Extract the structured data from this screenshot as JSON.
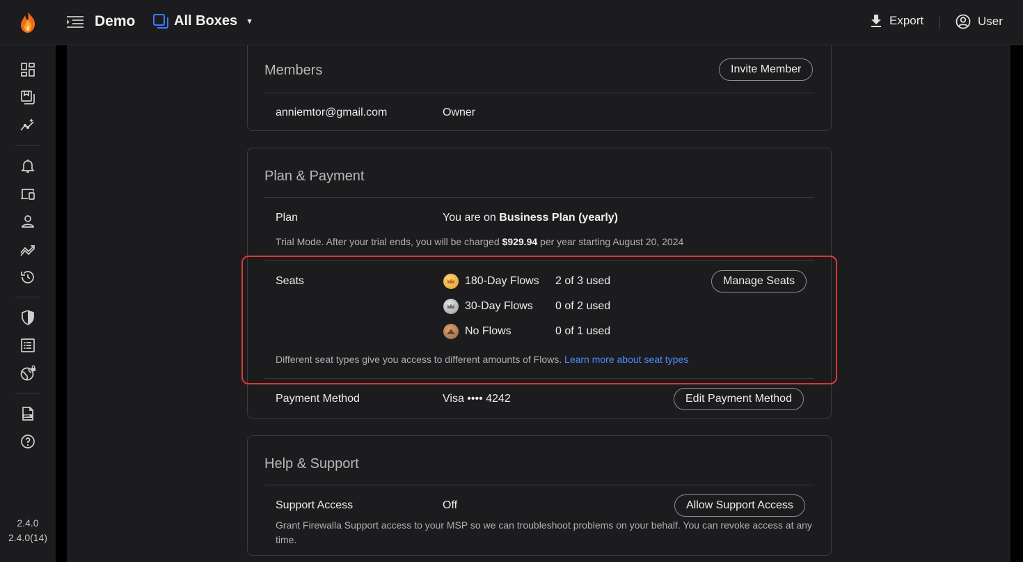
{
  "header": {
    "app_name": "Demo",
    "box_selector": "All Boxes",
    "export_label": "Export",
    "user_label": "User"
  },
  "sidebar": {
    "version": "2.4.0",
    "build": "2.4.0(14)"
  },
  "members": {
    "title": "Members",
    "invite_label": "Invite Member",
    "rows": [
      {
        "email": "anniemtor@gmail.com",
        "role": "Owner"
      }
    ]
  },
  "plan_payment": {
    "title": "Plan & Payment",
    "plan_label": "Plan",
    "plan_prefix": "You are on",
    "plan_name": "Business Plan (yearly)",
    "trial_prefix": "Trial Mode. After your trial ends, you will be charged",
    "trial_price": "$929.94",
    "trial_suffix": "per year starting August 20, 2024",
    "seats_label": "Seats",
    "manage_seats_label": "Manage Seats",
    "seats": [
      {
        "name": "180-Day Flows",
        "usage": "2 of 3 used",
        "tier": "gold"
      },
      {
        "name": "30-Day Flows",
        "usage": "0 of 2 used",
        "tier": "silver"
      },
      {
        "name": "No Flows",
        "usage": "0 of 1 used",
        "tier": "bronze"
      }
    ],
    "seats_note": "Different seat types give you access to different amounts of Flows.",
    "seats_link": "Learn more about seat types",
    "payment_label": "Payment Method",
    "payment_value": "Visa •••• 4242",
    "edit_payment_label": "Edit Payment Method"
  },
  "help_support": {
    "title": "Help & Support",
    "support_label": "Support Access",
    "support_value": "Off",
    "allow_label": "Allow Support Access",
    "note_line1": "Grant Firewalla Support access to your MSP so we can troubleshoot problems on your behalf. You can revoke access at any",
    "note_line2": "time."
  },
  "colors": {
    "accent_link": "#4a8cff",
    "highlight_border": "#d83a34",
    "logo_flame": "#f5a623"
  }
}
